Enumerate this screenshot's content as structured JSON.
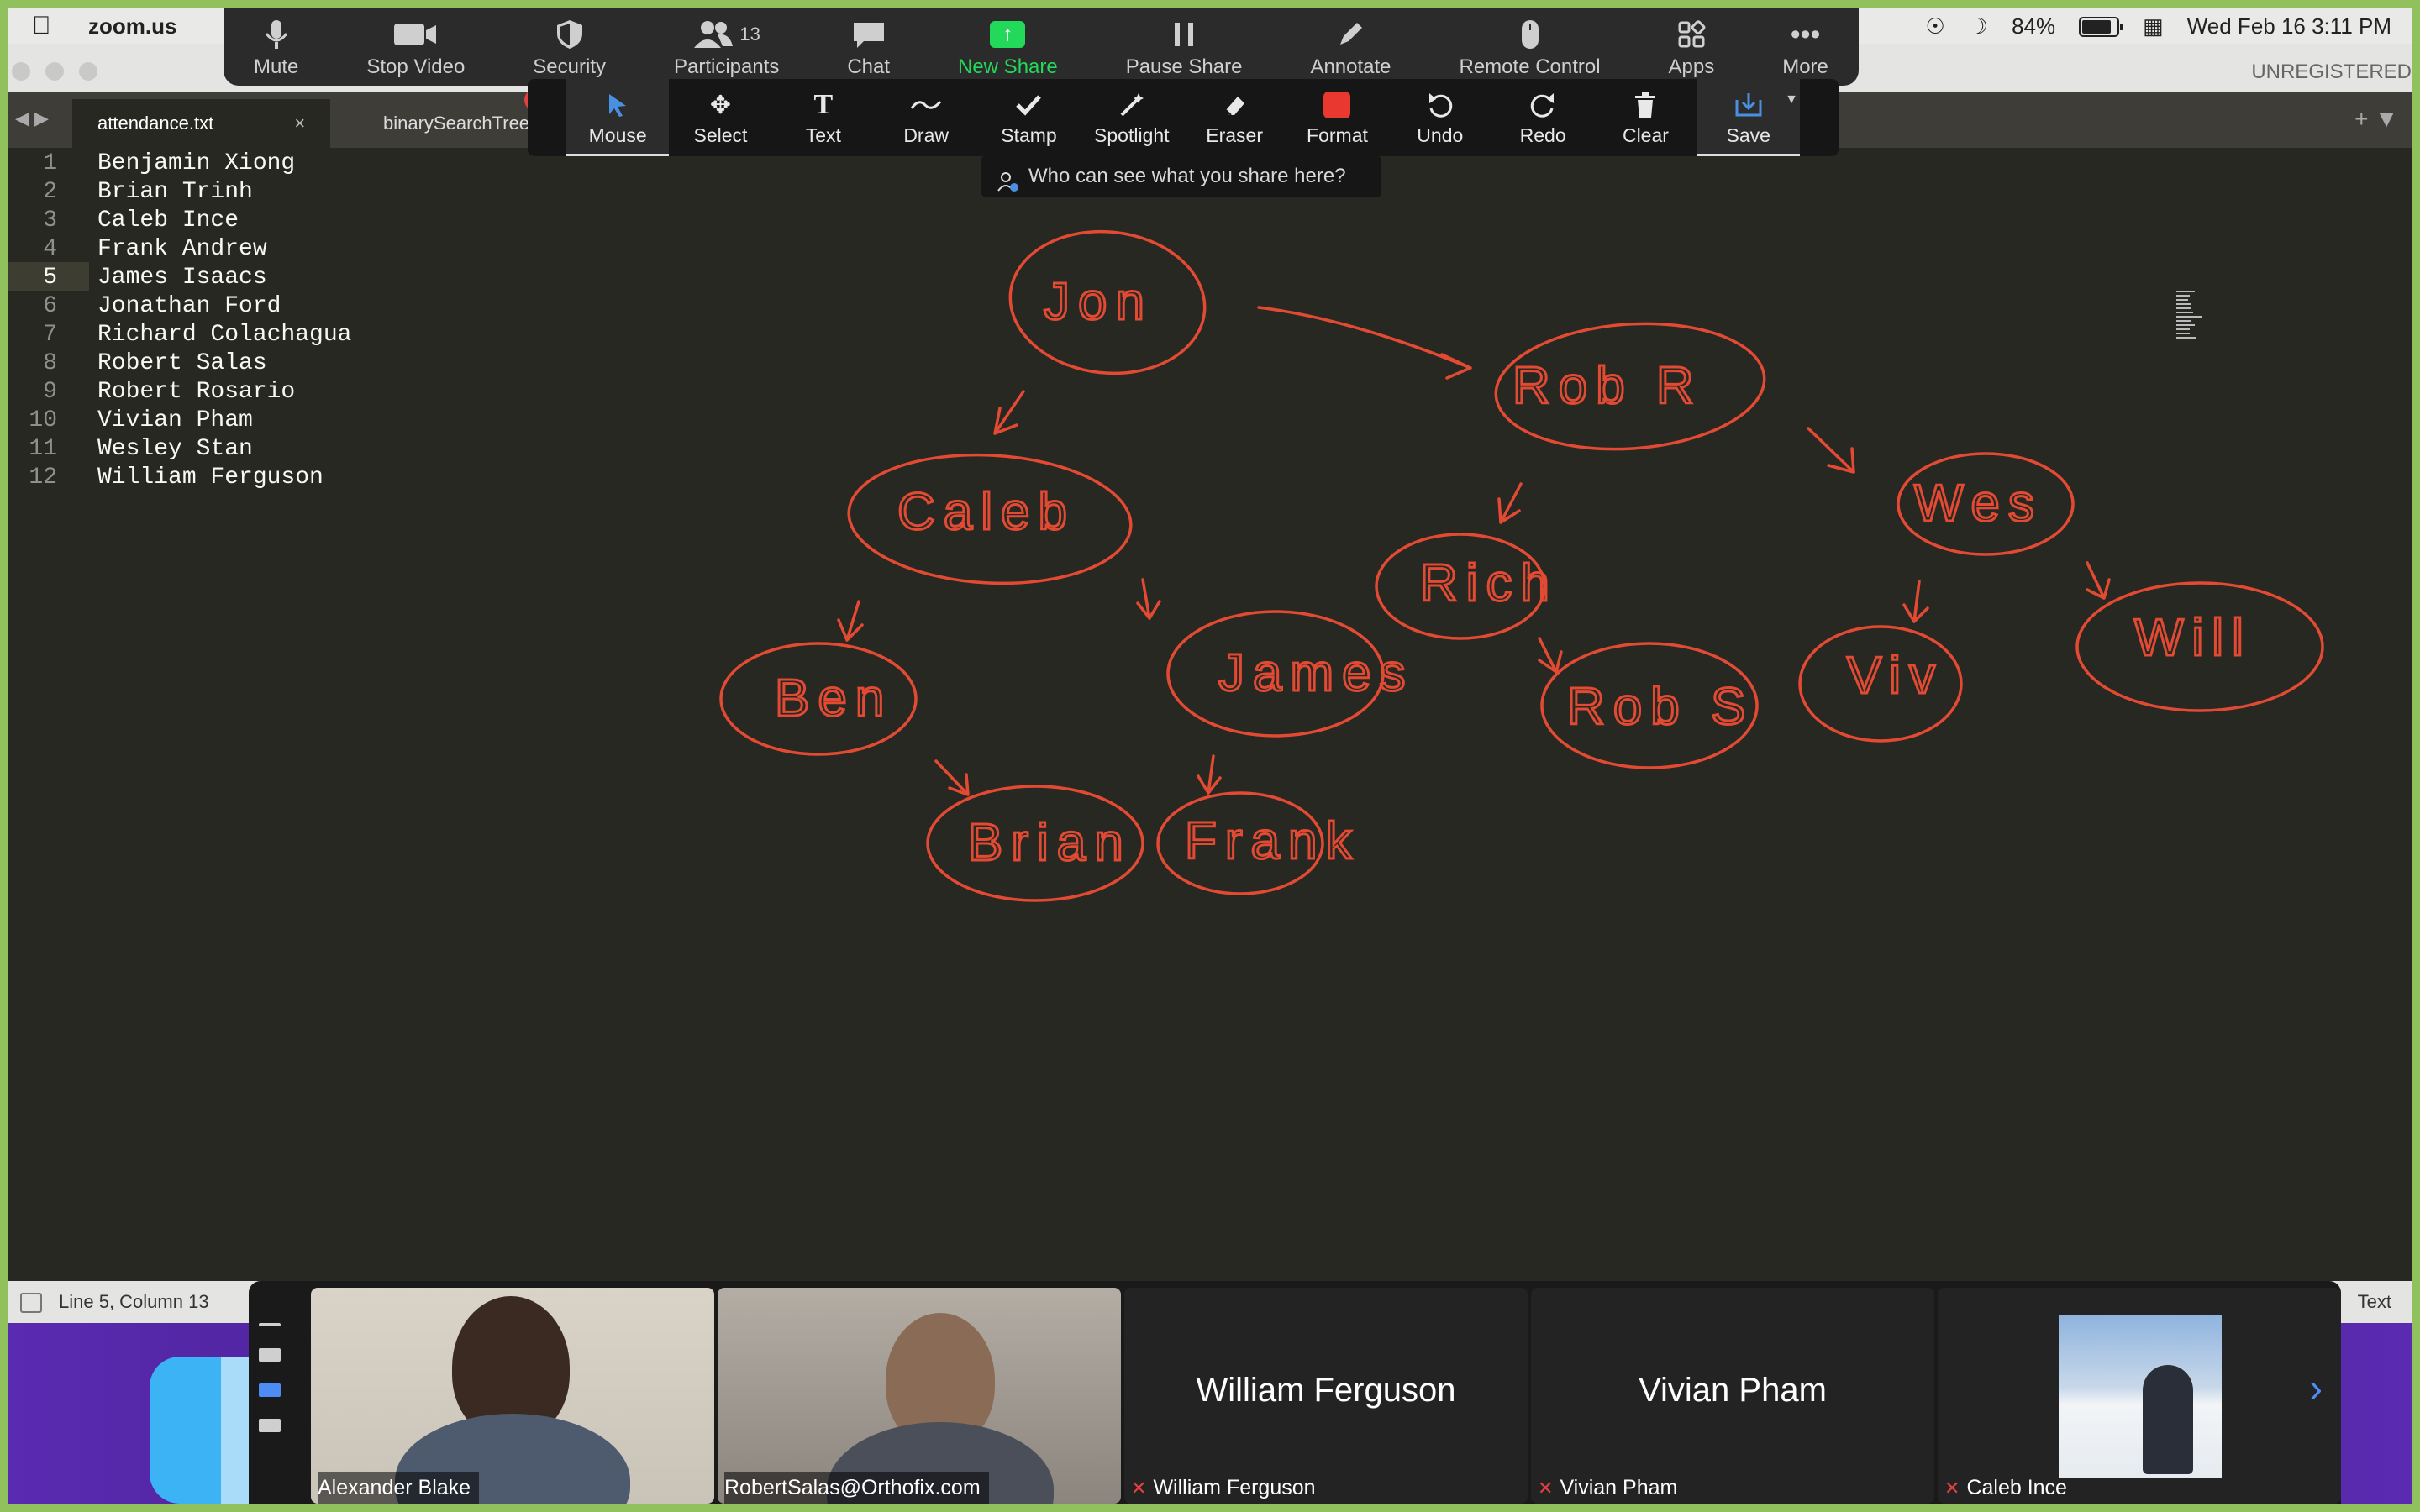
{
  "menubar": {
    "app_name": "zoom.us",
    "battery_pct": "84%",
    "battery_level": 0.84,
    "datetime": "Wed Feb 16  3:11 PM"
  },
  "window": {
    "unregistered": "UNREGISTERED"
  },
  "tabs": [
    {
      "label": "attendance.txt",
      "close": "×"
    },
    {
      "label": "binarySearchTree"
    }
  ],
  "zoom_toolbar": {
    "mute": "Mute",
    "stop_video": "Stop Video",
    "security": "Security",
    "participants": "Participants",
    "participants_count": "13",
    "chat": "Chat",
    "new_share": "New Share",
    "pause_share": "Pause Share",
    "annotate": "Annotate",
    "remote_control": "Remote Control",
    "apps": "Apps",
    "more": "More"
  },
  "annotate_toolbar": {
    "mouse": "Mouse",
    "select": "Select",
    "text": "Text",
    "draw": "Draw",
    "stamp": "Stamp",
    "spotlight": "Spotlight",
    "eraser": "Eraser",
    "format": "Format",
    "undo": "Undo",
    "redo": "Redo",
    "clear": "Clear",
    "save": "Save",
    "format_color": "#e8382f"
  },
  "share_notice": "Who can see what you share here?",
  "editor": {
    "lines": [
      {
        "n": "1",
        "text": "Benjamin Xiong"
      },
      {
        "n": "2",
        "text": "Brian Trinh"
      },
      {
        "n": "3",
        "text": "Caleb Ince"
      },
      {
        "n": "4",
        "text": "Frank Andrew"
      },
      {
        "n": "5",
        "text": "James Isaacs"
      },
      {
        "n": "6",
        "text": "Jonathan Ford"
      },
      {
        "n": "7",
        "text": "Richard Colachagua"
      },
      {
        "n": "8",
        "text": "Robert Salas"
      },
      {
        "n": "9",
        "text": "Robert Rosario"
      },
      {
        "n": "10",
        "text": "Vivian Pham"
      },
      {
        "n": "11",
        "text": "Wesley Stan"
      },
      {
        "n": "12",
        "text": "William Ferguson"
      }
    ],
    "status_position": "Line 5, Column 13",
    "status_right": "Text"
  },
  "tree_nodes": {
    "jon": "Jon",
    "rob_r": "Rob R",
    "caleb": "Caleb",
    "wes": "Wes",
    "rich": "Rich",
    "ben": "Ben",
    "james": "James",
    "rob_s": "Rob S",
    "viv": "Viv",
    "will": "Will",
    "brian": "Brian",
    "frank": "Frank"
  },
  "gallery": {
    "tiles": [
      {
        "caption": "Alexander Blake"
      },
      {
        "caption": "RobertSalas@Orthofix.com"
      },
      {
        "display": "William Ferguson",
        "caption": "William Ferguson"
      },
      {
        "display": "Vivian Pham",
        "caption": "Vivian Pham"
      },
      {
        "caption": "Caleb Ince"
      }
    ]
  },
  "colors": {
    "annotation": "#e34a33",
    "editor_bg": "#272822",
    "border": "#91c15c"
  }
}
